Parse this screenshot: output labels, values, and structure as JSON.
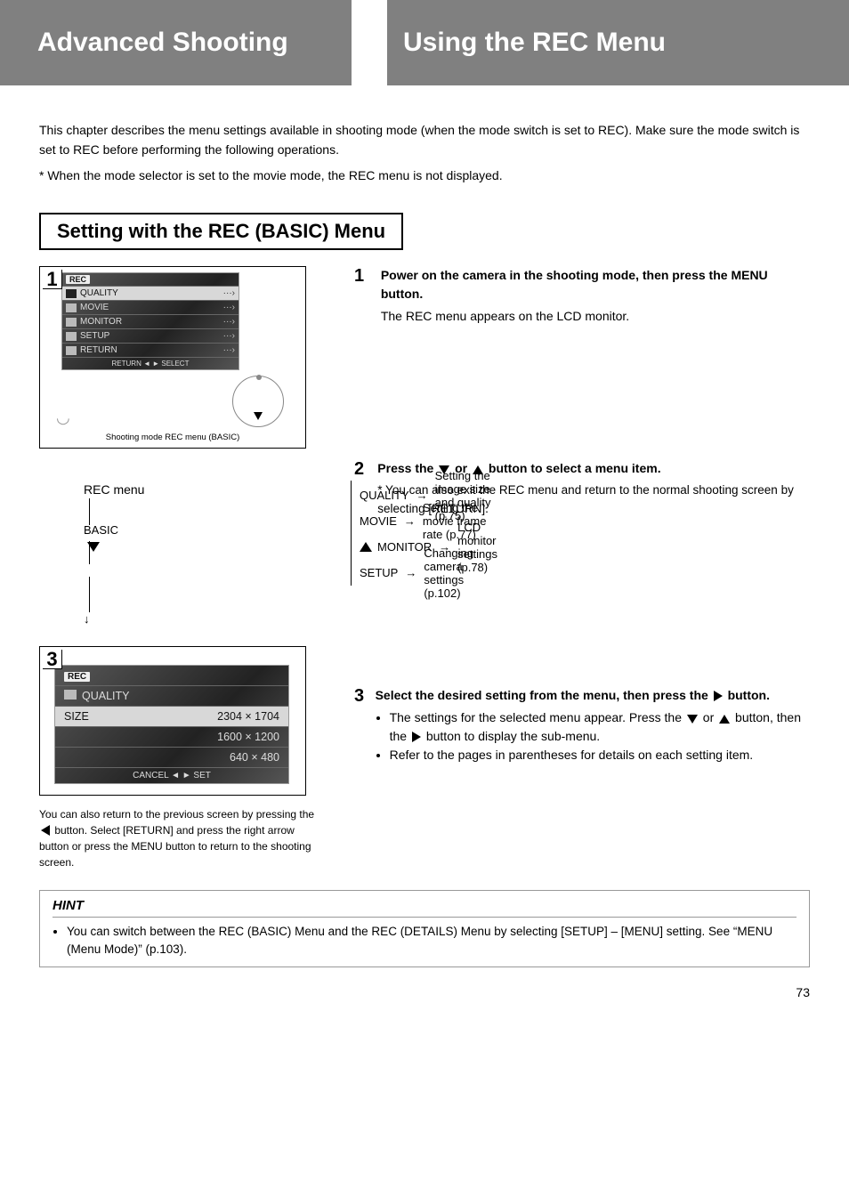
{
  "topbar": {
    "left": "Advanced Shooting",
    "right": "Using the REC Menu"
  },
  "intro": {
    "p1": "This chapter describes the menu settings available in shooting mode (when the mode switch is set to REC). Make sure the mode switch is set to REC before performing the following operations.",
    "note": "* When the mode selector is set to the movie mode, the REC menu is not displayed."
  },
  "section_heading": "Setting with the REC (BASIC) Menu",
  "screenshot1": {
    "tag": "1",
    "menu_title": "REC",
    "items": [
      "QUALITY",
      "MOVIE",
      "MONITOR",
      "SETUP",
      "RETURN"
    ],
    "footer": "RETURN ◄    ► SELECT",
    "bottom_caption": "Shooting mode REC menu (BASIC)"
  },
  "step1": {
    "no": "1",
    "head": "Power on the camera in the shooting mode, then press the MENU button.",
    "body": "The REC menu appears on the LCD monitor."
  },
  "menu_tree": {
    "root": "REC menu",
    "child": "BASIC",
    "a": {
      "l": "QUALITY",
      "r": "Setting the image size and quality (p.75)"
    },
    "b": {
      "l": "MOVIE",
      "r": "Setting the movie frame rate (p.77)"
    },
    "c": {
      "l": "MONITOR",
      "r": "LCD monitor settings (p.78)"
    },
    "d": {
      "l": "SETUP",
      "r": "Changing camera settings (p.102)"
    }
  },
  "step2": {
    "no": "2",
    "head_a": "Press the ",
    "head_b": " or ",
    "head_c": " button to select a menu item.",
    "star_a": "* You can also exit the REC menu and return to the normal shooting screen by selecting [RETURN]."
  },
  "screenshot2": {
    "tag": "3",
    "menu_title": "REC",
    "sub": "QUALITY",
    "size_label": "SIZE",
    "sizes": [
      "2304 × 1704",
      "1600 × 1200",
      "640 × 480"
    ],
    "footer": "CANCEL ◄   ► SET"
  },
  "step3": {
    "no": "3",
    "head_a": "Select the desired setting from the menu, then press the ",
    "head_b": " button.",
    "b1a": "The settings for the selected menu appear. Press the ",
    "b1b": " or ",
    "b1c": " button, then the ",
    "b1d": " button to display the sub-menu.",
    "b2": "Refer to the pages in parentheses for details on each setting item."
  },
  "left_note_a": "You can also return to the previous screen by pressing the ",
  "left_note_b": " button. Select [RETURN] and press the right arrow button or press the MENU button to return to the shooting screen.",
  "hint": {
    "head": "HINT",
    "item": "You can switch between the REC (BASIC) Menu and the REC (DETAILS) Menu by selecting [SETUP] – [MENU] setting. See “MENU (Menu Mode)” (p.103)."
  },
  "page_no": "73"
}
